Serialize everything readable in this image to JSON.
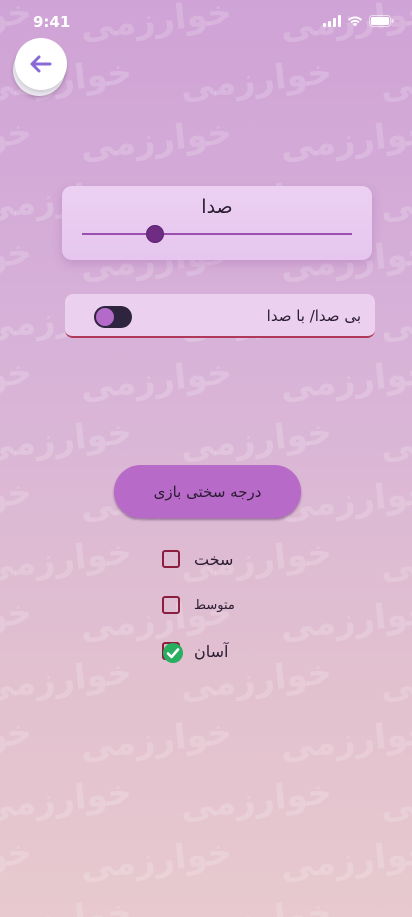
{
  "status_bar": {
    "time": "9:41"
  },
  "icons": {
    "back": "arrow-left-icon",
    "signal": "cellular-signal-icon",
    "wifi": "wifi-icon",
    "battery": "battery-icon",
    "check": "check-circle-icon"
  },
  "colors": {
    "accent": "#b86ac8",
    "slider": "#9a4fb0",
    "checkbox_border": "#8b1e3f",
    "check_fill": "#27ae60",
    "toggle_track": "#2e2440"
  },
  "watermark": {
    "text": "خوارزمی"
  },
  "sound": {
    "title": "صدا",
    "level": 0.27
  },
  "mute_toggle": {
    "label": "بی صدا/ با صدا",
    "on": false
  },
  "difficulty": {
    "label": "درجه سختی بازی",
    "options": [
      {
        "label": "سخت",
        "checked": false
      },
      {
        "label": "متوسط",
        "checked": false
      },
      {
        "label": "آسان",
        "checked": true
      }
    ]
  }
}
